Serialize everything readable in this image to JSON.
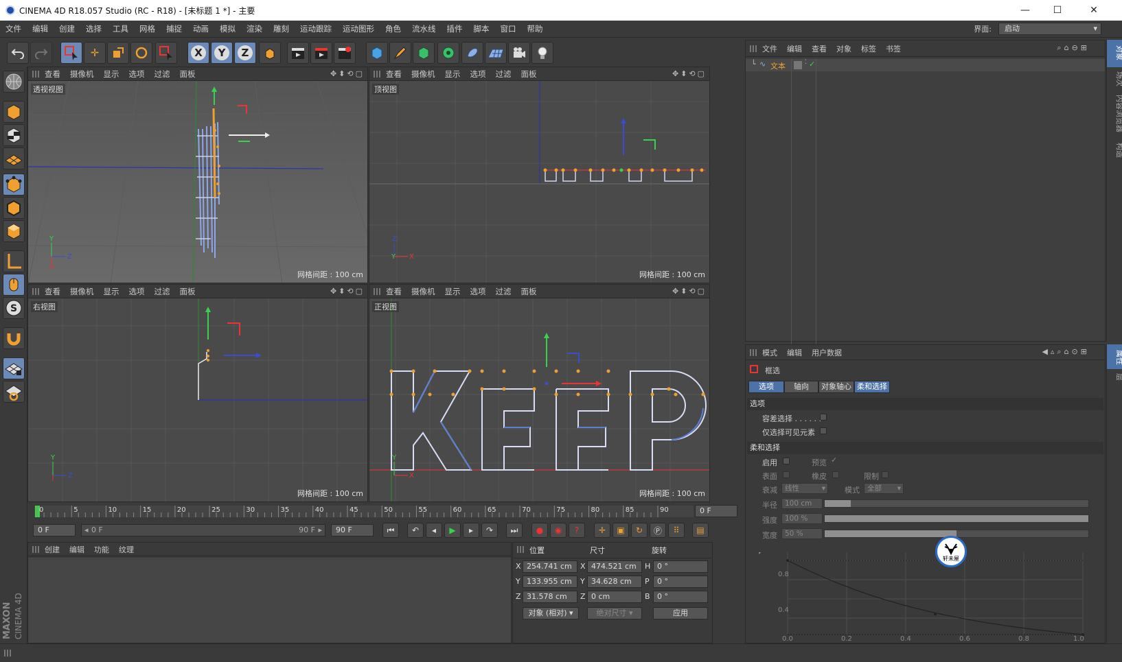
{
  "window": {
    "title": "CINEMA 4D R18.057 Studio (RC - R18) - [未标题 1 *] - 主要",
    "minimize_label": "—",
    "maximize_label": "☐",
    "close_label": "✕"
  },
  "menubar": {
    "items": [
      "文件",
      "编辑",
      "创建",
      "选择",
      "工具",
      "网格",
      "捕捉",
      "动画",
      "模拟",
      "渲染",
      "雕刻",
      "运动跟踪",
      "运动图形",
      "角色",
      "流水线",
      "插件",
      "脚本",
      "窗口",
      "帮助"
    ],
    "layout_label": "界面:",
    "layout_value": "启动"
  },
  "toolbar": {
    "axis_x": "X",
    "axis_y": "Y",
    "axis_z": "Z"
  },
  "viewport_menu": [
    "查看",
    "摄像机",
    "显示",
    "选项",
    "过滤",
    "面板"
  ],
  "viewports": [
    {
      "title": "透视视图",
      "grid": "网格间距 : 100 cm"
    },
    {
      "title": "顶视图",
      "grid": "网格间距 : 100 cm"
    },
    {
      "title": "右视图",
      "grid": "网格间距 : 100 cm"
    },
    {
      "title": "正视图",
      "grid": "网格间距 : 100 cm"
    }
  ],
  "axes_labels": {
    "x": "X",
    "y": "Y",
    "z": "Z"
  },
  "timeline": {
    "ticks": [
      "0",
      "5",
      "10",
      "15",
      "20",
      "25",
      "30",
      "35",
      "40",
      "45",
      "50",
      "55",
      "60",
      "65",
      "70",
      "75",
      "80",
      "85",
      "90"
    ],
    "current_frame": "0 F",
    "start_field": "0 F",
    "range_start": "0 F",
    "range_end": "90 F",
    "end_field": "90 F"
  },
  "material_manager": {
    "menu": [
      "创建",
      "编辑",
      "功能",
      "纹理"
    ]
  },
  "coordinates": {
    "col_position": "位置",
    "col_size": "尺寸",
    "col_rotation": "旋转",
    "rows": [
      {
        "axis": "X",
        "pos": "254.741 cm",
        "size_axis": "X",
        "size": "474.521 cm",
        "rot_axis": "H",
        "rot": "0 °"
      },
      {
        "axis": "Y",
        "pos": "133.955 cm",
        "size_axis": "Y",
        "size": "34.628 cm",
        "rot_axis": "P",
        "rot": "0 °"
      },
      {
        "axis": "Z",
        "pos": "31.578 cm",
        "size_axis": "Z",
        "size": "0 cm",
        "rot_axis": "B",
        "rot": "0 °"
      }
    ],
    "mode_select": "对象 (相对)",
    "size_select": "绝对尺寸",
    "apply_label": "应用"
  },
  "brand": {
    "maxon": "MAXON",
    "product": "CINEMA 4D"
  },
  "object_manager": {
    "menu": [
      "文件",
      "编辑",
      "查看",
      "对象",
      "标签",
      "书签"
    ],
    "objects": [
      {
        "name": "文本"
      }
    ]
  },
  "right_tabs_top": [
    "对象",
    "场次",
    "内容浏览器",
    "构造"
  ],
  "right_tabs_bottom": [
    "属性",
    "层"
  ],
  "attribute_manager": {
    "menu": [
      "模式",
      "编辑",
      "用户数据"
    ],
    "tool_name": "框选",
    "tabs": [
      "选项",
      "轴向",
      "对象轴心",
      "柔和选择"
    ],
    "section_options": "选项",
    "tolerant_label": "容差选择 . . . . . .",
    "visible_only_label": "仅选择可见元素",
    "section_soft": "柔和选择",
    "enable_label": "启用",
    "preview_label": "预览",
    "surface_label": "表面",
    "rubber_label": "橡皮",
    "restrict_label": "限制",
    "falloff_label": "衰减",
    "falloff_value": "线性",
    "mode_label": "模式",
    "mode_value": "全部",
    "radius_label": "半径",
    "radius_value": "100 cm",
    "strength_label": "强度",
    "strength_value": "100 %",
    "width_label": "宽度",
    "width_value": "50 %",
    "strength_fraction": 1.0,
    "width_fraction": 0.5,
    "radius_fraction": 0.1
  },
  "curve": {
    "y_ticks": [
      "0.8",
      "0.4"
    ],
    "x_ticks": [
      "0.0",
      "0.2",
      "0.4",
      "0.6",
      "0.8",
      "1.0"
    ]
  },
  "watermark": {
    "text": "轩未屋"
  }
}
